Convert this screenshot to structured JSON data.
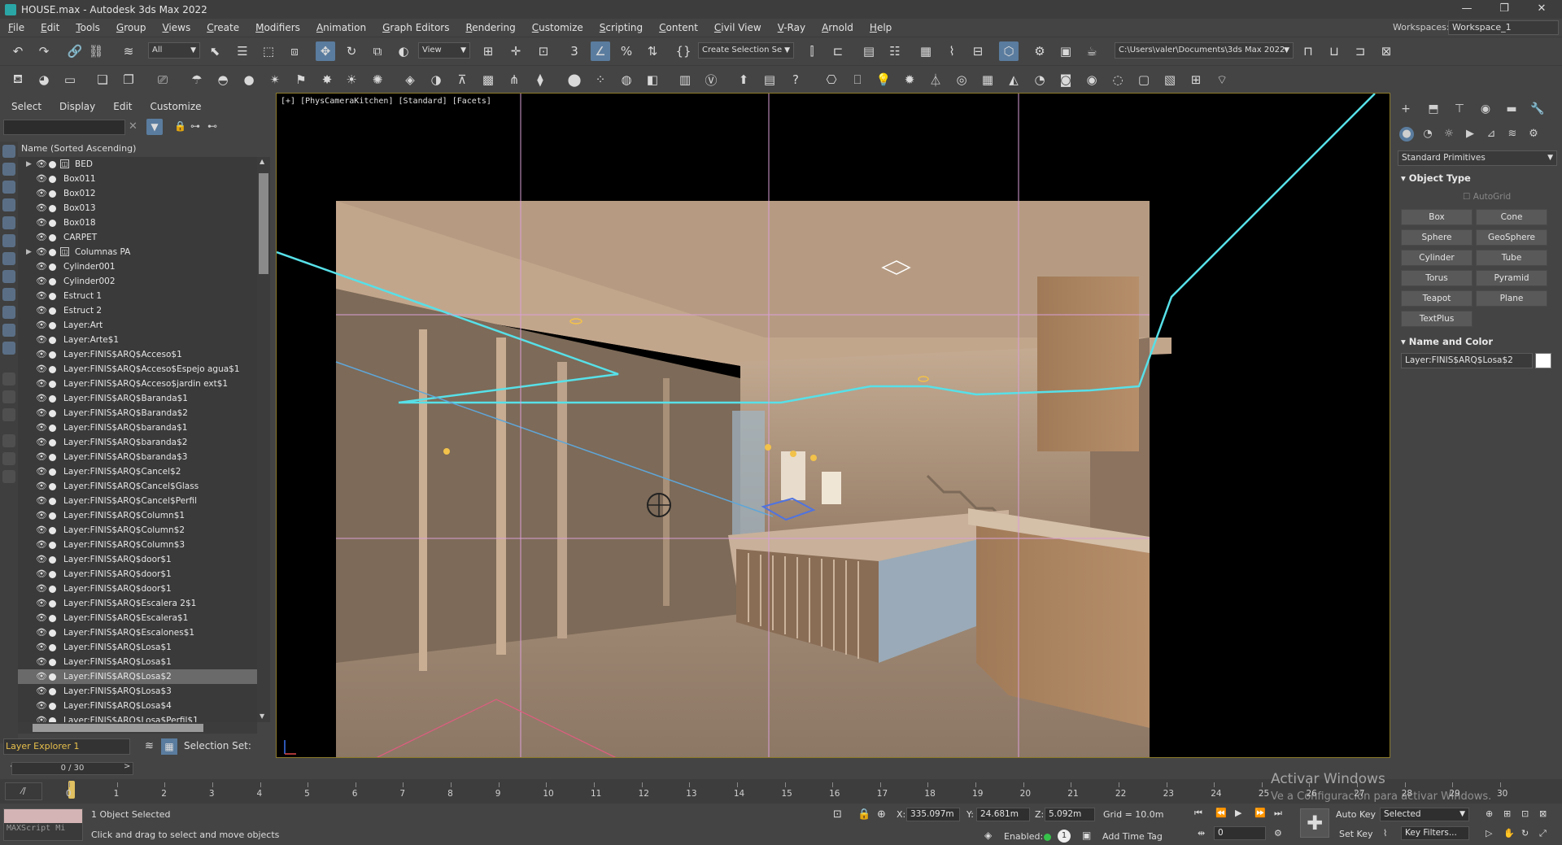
{
  "window": {
    "title": "HOUSE.max - Autodesk 3ds Max 2022",
    "minimize": "—",
    "maximize": "❐",
    "close": "✕"
  },
  "menu": [
    "File",
    "Edit",
    "Tools",
    "Group",
    "Views",
    "Create",
    "Modifiers",
    "Animation",
    "Graph Editors",
    "Rendering",
    "Customize",
    "Scripting",
    "Content",
    "Civil View",
    "V-Ray",
    "Arnold",
    "Help"
  ],
  "workspace": {
    "label": "Workspaces:",
    "value": "Workspace_1"
  },
  "toolbar1": {
    "filter_value": "All",
    "view_value": "View",
    "selection_set_value": "Create Selection Se",
    "path_value": "C:\\Users\\valer\\Documents\\3ds Max 2022"
  },
  "scene_explorer": {
    "tabs": [
      "Select",
      "Display",
      "Edit",
      "Customize"
    ],
    "header": "Name (Sorted Ascending)",
    "items": [
      {
        "label": "BED",
        "group": true
      },
      {
        "label": "Box011"
      },
      {
        "label": "Box012"
      },
      {
        "label": "Box013"
      },
      {
        "label": "Box018"
      },
      {
        "label": "CARPET"
      },
      {
        "label": "Columnas PA",
        "group": true
      },
      {
        "label": "Cylinder001"
      },
      {
        "label": "Cylinder002"
      },
      {
        "label": "Estruct 1"
      },
      {
        "label": "Estruct 2"
      },
      {
        "label": "Layer:Art"
      },
      {
        "label": "Layer:Arte$1"
      },
      {
        "label": "Layer:FINIS$ARQ$Acceso$1"
      },
      {
        "label": "Layer:FINIS$ARQ$Acceso$Espejo agua$1"
      },
      {
        "label": "Layer:FINIS$ARQ$Acceso$jardin ext$1"
      },
      {
        "label": "Layer:FINIS$ARQ$Baranda$1"
      },
      {
        "label": "Layer:FINIS$ARQ$Baranda$2"
      },
      {
        "label": "Layer:FINIS$ARQ$baranda$1"
      },
      {
        "label": "Layer:FINIS$ARQ$baranda$2"
      },
      {
        "label": "Layer:FINIS$ARQ$baranda$3"
      },
      {
        "label": "Layer:FINIS$ARQ$Cancel$2"
      },
      {
        "label": "Layer:FINIS$ARQ$Cancel$Glass"
      },
      {
        "label": "Layer:FINIS$ARQ$Cancel$Perfil"
      },
      {
        "label": "Layer:FINIS$ARQ$Column$1"
      },
      {
        "label": "Layer:FINIS$ARQ$Column$2"
      },
      {
        "label": "Layer:FINIS$ARQ$Column$3"
      },
      {
        "label": "Layer:FINIS$ARQ$door$1"
      },
      {
        "label": "Layer:FINIS$ARQ$door$1"
      },
      {
        "label": "Layer:FINIS$ARQ$door$1"
      },
      {
        "label": "Layer:FINIS$ARQ$Escalera 2$1"
      },
      {
        "label": "Layer:FINIS$ARQ$Escalera$1"
      },
      {
        "label": "Layer:FINIS$ARQ$Escalones$1"
      },
      {
        "label": "Layer:FINIS$ARQ$Losa$1"
      },
      {
        "label": "Layer:FINIS$ARQ$Losa$1"
      },
      {
        "label": "Layer:FINIS$ARQ$Losa$2",
        "selected": true
      },
      {
        "label": "Layer:FINIS$ARQ$Losa$3"
      },
      {
        "label": "Layer:FINIS$ARQ$Losa$4"
      },
      {
        "label": "Layer:FINIS$ARQ$Losa$Perfil$1"
      }
    ],
    "explorer_name": "Layer Explorer 1",
    "selection_set_label": "Selection Set:"
  },
  "viewport": {
    "label": "[+] [PhysCameraKitchen] [Standard] [Facets]"
  },
  "command_panel": {
    "category": "Standard Primitives",
    "object_type_title": "Object Type",
    "autogrid": "AutoGrid",
    "buttons": [
      "Box",
      "Cone",
      "Sphere",
      "GeoSphere",
      "Cylinder",
      "Tube",
      "Torus",
      "Pyramid",
      "Teapot",
      "Plane",
      "TextPlus"
    ],
    "name_color_title": "Name and Color",
    "name_value": "Layer:FINIS$ARQ$Losa$2",
    "object_color": "#ffffff"
  },
  "timeline": {
    "frame_counter": "0 / 30",
    "ticks": [
      "0",
      "1",
      "2",
      "3",
      "4",
      "5",
      "6",
      "7",
      "8",
      "9",
      "10",
      "11",
      "12",
      "13",
      "14",
      "15",
      "16",
      "17",
      "18",
      "19",
      "20",
      "21",
      "22",
      "23",
      "24",
      "25",
      "26",
      "27",
      "28",
      "29",
      "30"
    ]
  },
  "status": {
    "maxscript": "MAXScript Mi",
    "selected": "1 Object Selected",
    "prompt": "Click and drag to select and move objects",
    "x_label": "X:",
    "x_value": "335.097m",
    "y_label": "Y:",
    "y_value": "24.681m",
    "z_label": "Z:",
    "z_value": "5.092m",
    "grid": "Grid = 10.0m",
    "enabled": "Enabled:",
    "add_time_tag": "Add Time Tag",
    "auto_key": "Auto Key",
    "set_key": "Set Key",
    "key_mode": "Selected",
    "key_filters": "Key Filters...",
    "current_frame": "0",
    "watermark_line1": "Activar Windows",
    "watermark_line2": "Ve a Configuración para activar Windows."
  },
  "colors": {
    "accent": "#5a7c9e",
    "viewport_border": "#8c7a2a",
    "light_blue_line": "#57e0e8"
  }
}
